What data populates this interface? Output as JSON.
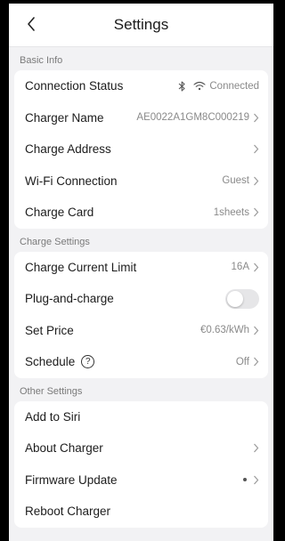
{
  "nav": {
    "title": "Settings",
    "back_icon": "chevron-left-icon"
  },
  "sections": {
    "basic": {
      "label": "Basic Info",
      "connection_status": {
        "label": "Connection Status",
        "value": "Connected"
      },
      "charger_name": {
        "label": "Charger Name",
        "value": "AE0022A1GM8C000219"
      },
      "charge_address": {
        "label": "Charge Address"
      },
      "wifi": {
        "label": "Wi-Fi Connection",
        "value": "Guest"
      },
      "charge_card": {
        "label": "Charge Card",
        "value": "1sheets"
      }
    },
    "charge": {
      "label": "Charge Settings",
      "current_limit": {
        "label": "Charge Current Limit",
        "value": "16A"
      },
      "plug_and_charge": {
        "label": "Plug-and-charge",
        "enabled": false
      },
      "set_price": {
        "label": "Set Price",
        "value": "€0.63/kWh"
      },
      "schedule": {
        "label": "Schedule",
        "help": "?",
        "value": "Off"
      }
    },
    "other": {
      "label": "Other Settings",
      "add_to_siri": {
        "label": "Add to Siri"
      },
      "about_charger": {
        "label": "About Charger"
      },
      "firmware_update": {
        "label": "Firmware Update"
      },
      "reboot_charger": {
        "label": "Reboot Charger"
      }
    }
  },
  "colors": {
    "background": "#f2f2f4",
    "card": "#ffffff",
    "secondary_text": "#8a8a8a",
    "toggle_off": "#e6e6e8"
  }
}
